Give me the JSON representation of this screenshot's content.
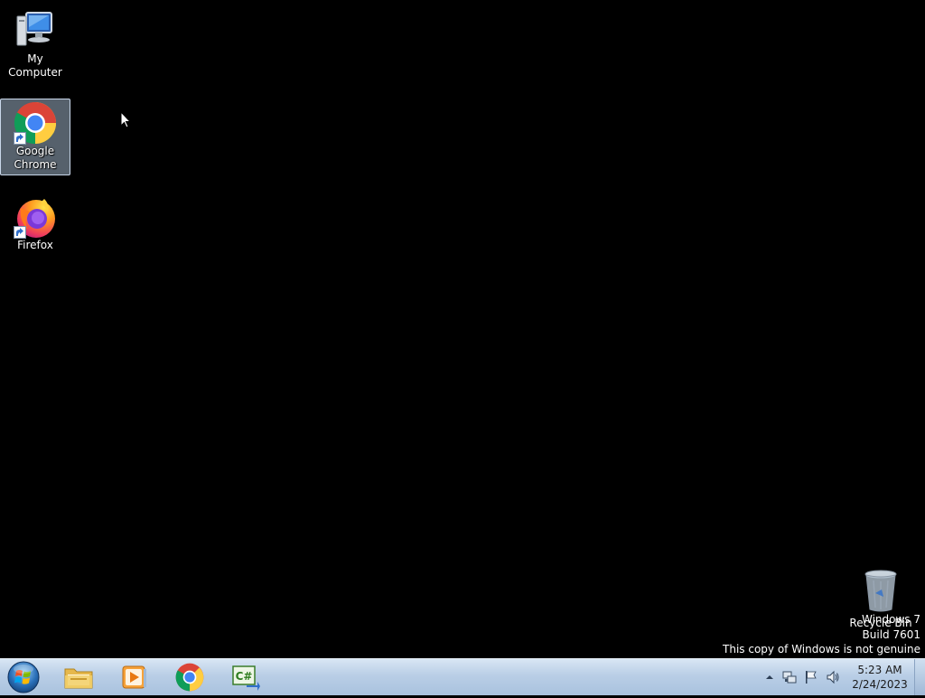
{
  "desktop": {
    "icons": [
      {
        "label": "My Computer",
        "icon": "computer-icon"
      },
      {
        "label": "Google\nChrome",
        "icon": "chrome-icon",
        "selected": true
      },
      {
        "label": "Firefox",
        "icon": "firefox-icon"
      }
    ],
    "recycle_bin": {
      "label": "Recycle Bin",
      "icon": "recycle-bin-icon"
    },
    "watermark": {
      "line1": "Windows 7",
      "line2": "Build 7601",
      "line3": "This copy of Windows is not genuine"
    }
  },
  "taskbar": {
    "start_icon": "windows-start-orb",
    "pinned": [
      {
        "name": "Windows Explorer",
        "icon": "folder-icon"
      },
      {
        "name": "Windows Media Player",
        "icon": "media-player-icon"
      },
      {
        "name": "Google Chrome",
        "icon": "chrome-icon"
      },
      {
        "name": "C# Editor",
        "icon": "csharp-icon"
      }
    ],
    "tray": {
      "icons": [
        "show-hidden-icons-arrow",
        "network-icon",
        "action-center-flag-icon",
        "volume-icon"
      ],
      "time": "5:23 AM",
      "date": "2/24/2023"
    }
  },
  "colors": {
    "desktop_bg": "#000000",
    "taskbar_top": "#d8e6f4",
    "taskbar_bottom": "#a9c2de",
    "selection": "#bed7f0"
  }
}
